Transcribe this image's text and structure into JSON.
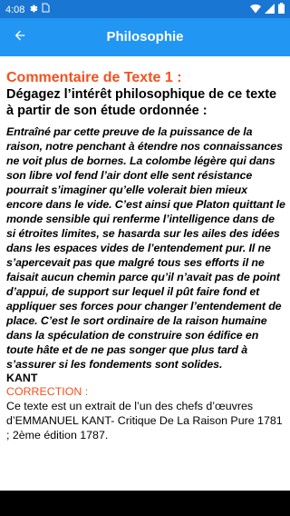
{
  "status_bar": {
    "time": "4:08"
  },
  "app_bar": {
    "title": "Philosophie"
  },
  "content": {
    "heading": "Commentaire de Texte 1 :",
    "subject": "Dégagez l’intérêt philosophique de ce texte à partir de son étude ordonnée :",
    "quote": "Entraîné par cette preuve de la puissance de la raison, notre penchant à étendre nos connaissances ne voit plus de bornes. La colombe légère qui dans son libre vol fend l’air dont elle sent résistance pourrait s’imaginer qu’elle volerait bien mieux encore dans le vide. C’est ainsi que Platon quittant le monde sensible qui renferme l’intelligence dans de si étroites limites, se hasarda sur les ailes des idées dans les espaces vides de l’entendement pur. Il ne s’apercevait pas que malgré tous ses efforts il ne faisait aucun chemin parce qu’il n’avait pas de point d’appui, de support sur lequel il pût faire fond et appliquer ses forces pour changer l’entendement de place. C’est le sort ordinaire de la raison humaine dans la spéculation de construire son édifice en toute hâte et de ne pas songer que plus tard à s’assurer si les fondements sont solides.",
    "author": "KANT",
    "correction_label": "CORRECTION :",
    "correction_text": "Ce texte est un extrait de l’un des chefs d’œuvres d’EMMANUEL KANT- Critique De La Raison Pure 1781 ; 2ème édition 1787."
  },
  "icons": {
    "back": "arrow-back-icon",
    "settings": "gear-icon",
    "sim": "sim-card-icon",
    "wifi": "wifi-icon",
    "signal": "cell-signal-icon",
    "battery": "battery-icon"
  },
  "colors": {
    "status_bar": "#1976d2",
    "app_bar": "#2196f3",
    "accent": "#f4511e"
  }
}
